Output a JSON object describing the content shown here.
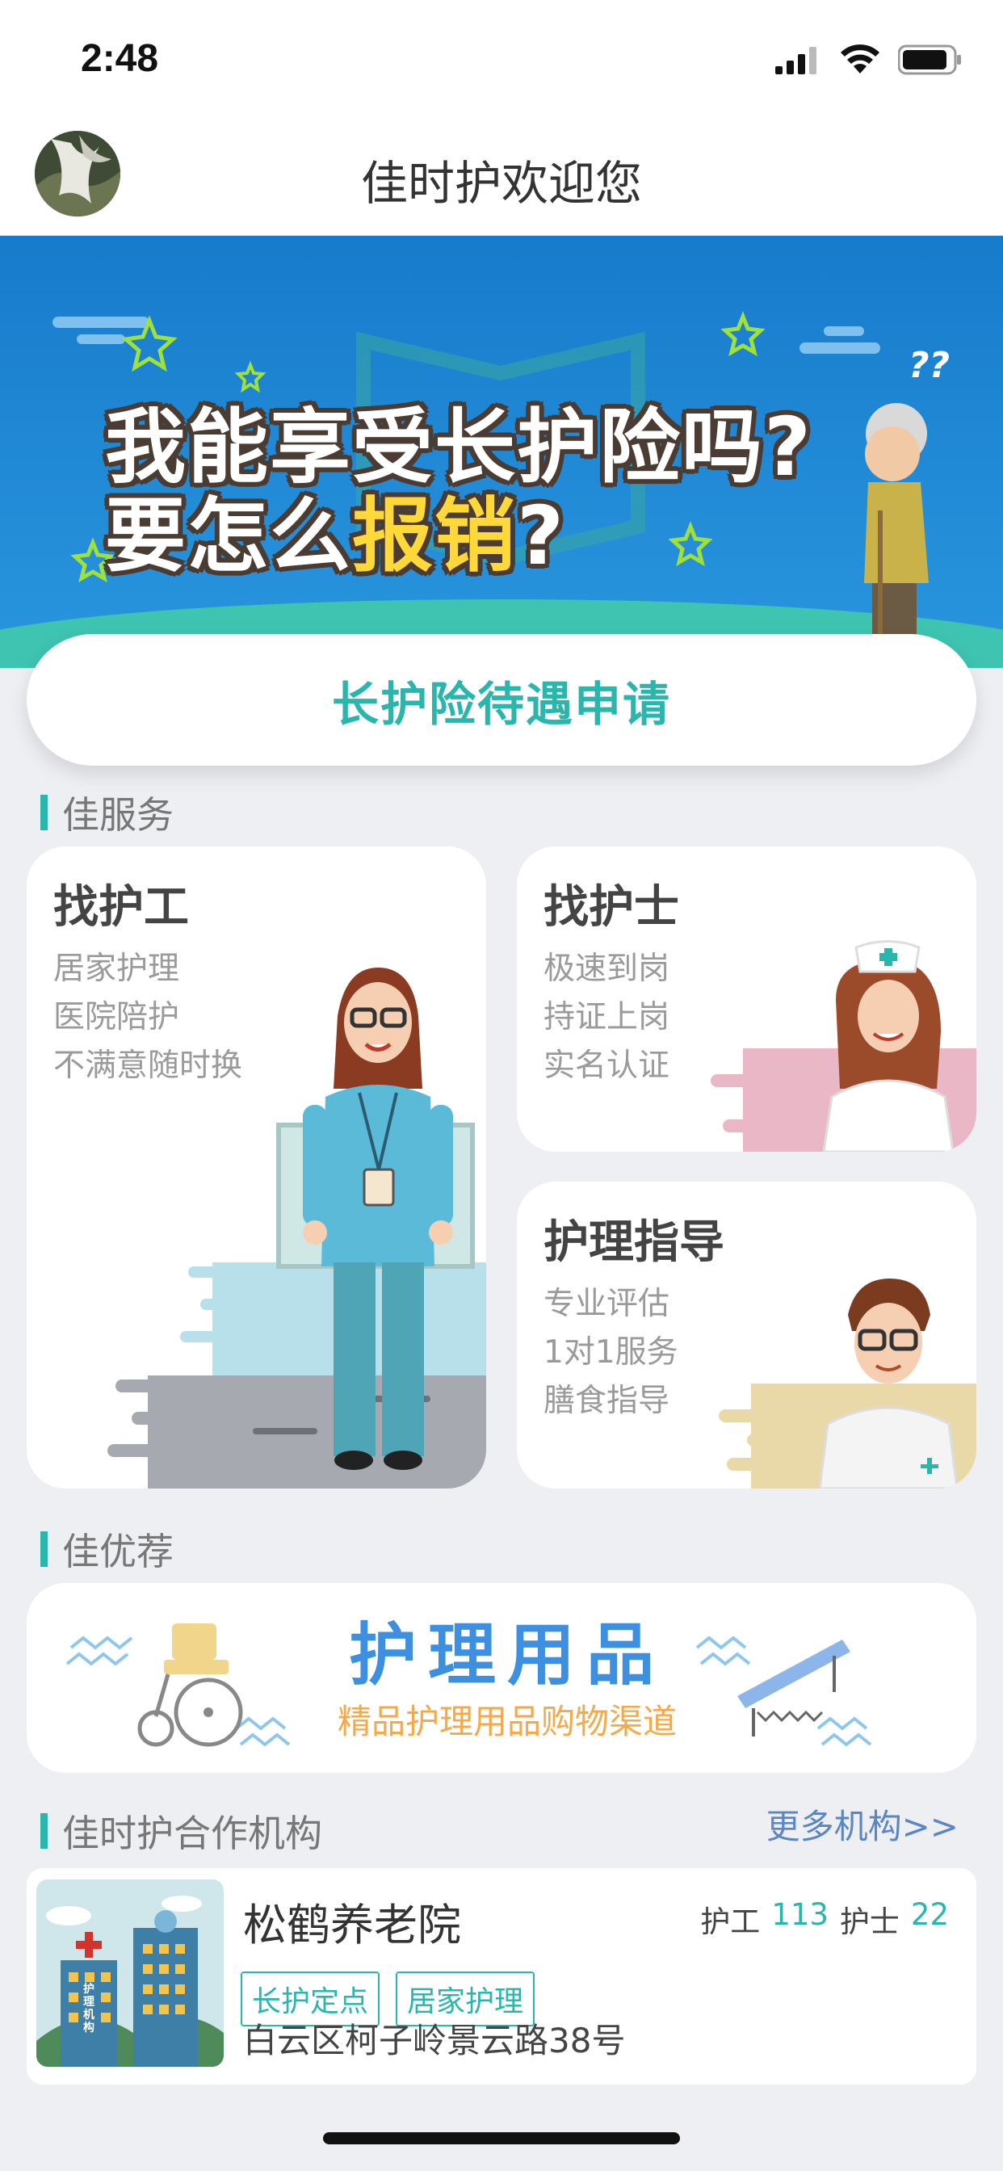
{
  "status_bar": {
    "time": "2:48",
    "icons": [
      "signal-icon",
      "wifi-icon",
      "battery-icon"
    ]
  },
  "header": {
    "title": "佳时护欢迎您"
  },
  "banner": {
    "line1": "我能享受长护险吗?",
    "line2_prefix": "要怎么",
    "line2_highlight": "报销",
    "line2_suffix": "?",
    "decoration": "??"
  },
  "apply_button": {
    "label": "长护险待遇申请"
  },
  "services": {
    "title": "佳服务",
    "caregiver": {
      "title": "找护工",
      "items": [
        "居家护理",
        "医院陪护",
        "不满意随时换"
      ]
    },
    "nurse": {
      "title": "找护士",
      "items": [
        "极速到岗",
        "持证上岗",
        "实名认证"
      ]
    },
    "guidance": {
      "title": "护理指导",
      "items": [
        "专业评估",
        "1对1服务",
        "膳食指导"
      ]
    }
  },
  "recommend": {
    "title": "佳优荐",
    "banner_title": "护理用品",
    "banner_subtitle": "精品护理用品购物渠道"
  },
  "partners": {
    "title": "佳时护合作机构",
    "more": "更多机构>>",
    "items": [
      {
        "name": "松鹤养老院",
        "caregiver_label": "护工",
        "caregiver_count": "113",
        "nurse_label": "护士",
        "nurse_count": "22",
        "tags": [
          "长护定点",
          "居家护理"
        ],
        "address": "白云区柯子岭景云路38号",
        "image_text": "护理机构"
      }
    ]
  },
  "colors": {
    "accent": "#2ab5ad",
    "banner_bg": "#1e88d6",
    "link": "#5b86c5",
    "highlight": "#ffd83a"
  }
}
